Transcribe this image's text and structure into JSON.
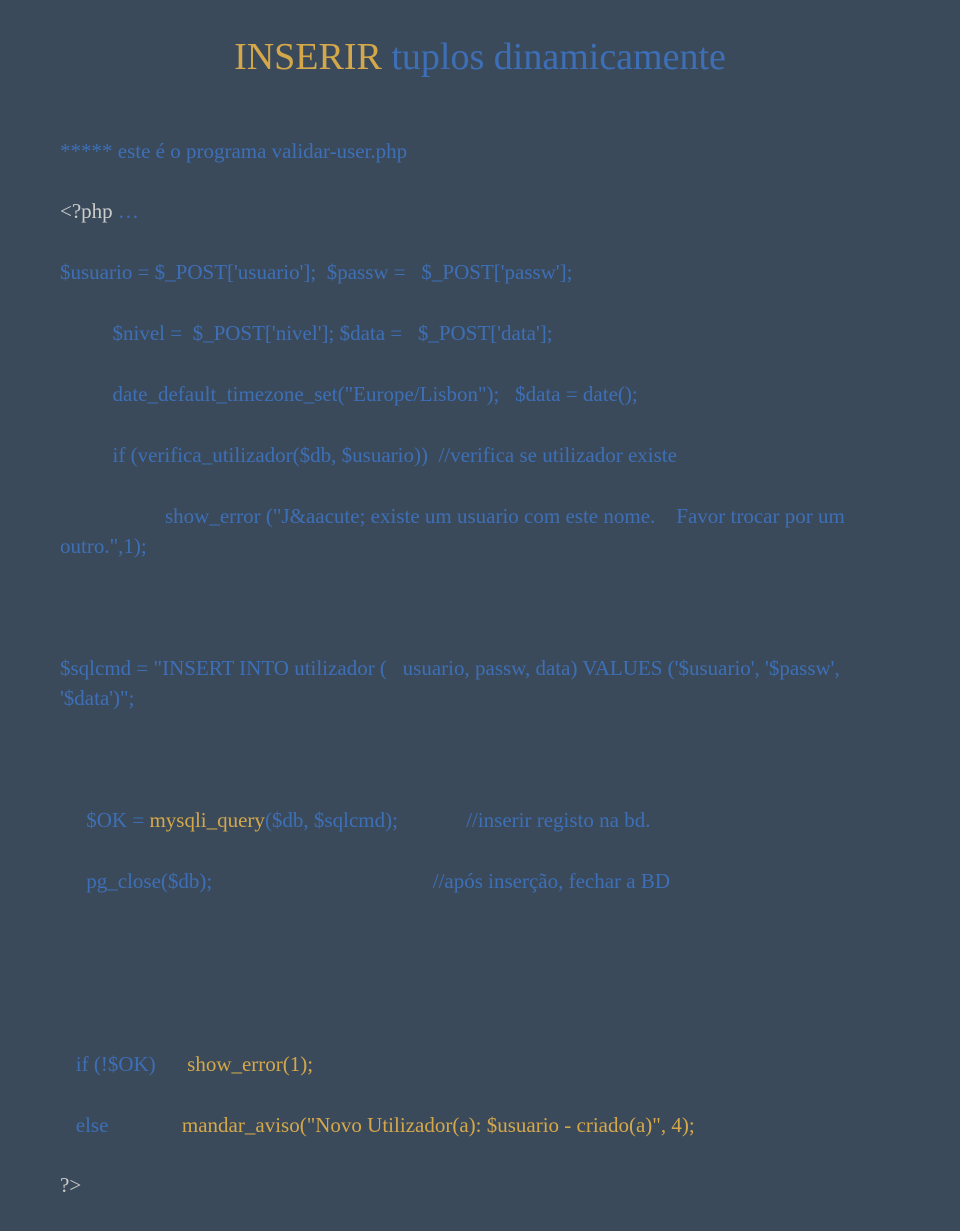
{
  "title_part1": "INSERIR",
  "title_part2": " tuplos dinamicamente",
  "line1": "***** este é o programa validar-user.php",
  "line2a": "<?php",
  "line2b": " …",
  "line3": "$usuario = $_POST['usuario'];  $passw =   $_POST['passw'];",
  "line4": "          $nivel =  $_POST['nivel']; $data =   $_POST['data'];",
  "line5": "          date_default_timezone_set(\"Europe/Lisbon\");   $data = date();",
  "line6": "          if (verifica_utilizador($db, $usuario))  //verifica se utilizador existe",
  "line7": "                    show_error (\"J&aacute; existe um usuario com este nome.    Favor trocar por um outro.\",1);",
  "line8": "$sqlcmd = \"INSERT INTO utilizador (   usuario, passw, data) VALUES ('$usuario', '$passw',  '$data')\";",
  "line9a": "     $OK = ",
  "line9b": "mysqli_query",
  "line9c": "($db, $sqlcmd);",
  "line9d": "             //inserir registo na bd.",
  "line10a": "     pg_close($db);",
  "line10b": "                                          //após inserção, fechar a BD",
  "line11a": "   if (!$OK)      ",
  "line11b": "show_error(1);",
  "line12a": "   else              ",
  "line12b": "mandar_aviso(\"Novo Utilizador(a): $usuario - criado(a)\", 4);",
  "line13": "?>"
}
